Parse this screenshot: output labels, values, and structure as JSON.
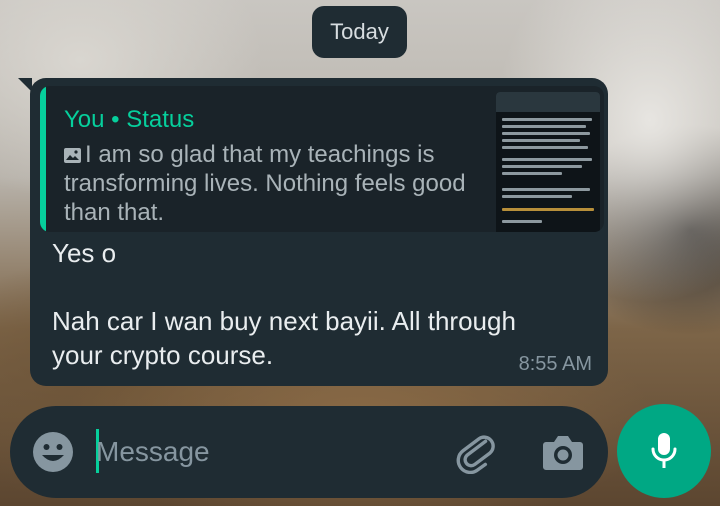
{
  "chat": {
    "date_label": "Today"
  },
  "message": {
    "quote": {
      "author": "You • Status",
      "text": "I am so glad that my teachings is transforming lives. Nothing feels good than that.",
      "thumbnail_icon": "photo-icon"
    },
    "body": "Yes o\n\nNah car I wan buy next bayii. All through your crypto course.",
    "time": "8:55 AM"
  },
  "composer": {
    "placeholder": "Message",
    "emoji_icon": "emoji-icon",
    "attach_icon": "paperclip-icon",
    "camera_icon": "camera-icon",
    "send_icon": "mic-icon"
  },
  "colors": {
    "accent": "#06cf9c",
    "bubble": "#1f2c33",
    "mic_button": "#00a884"
  }
}
